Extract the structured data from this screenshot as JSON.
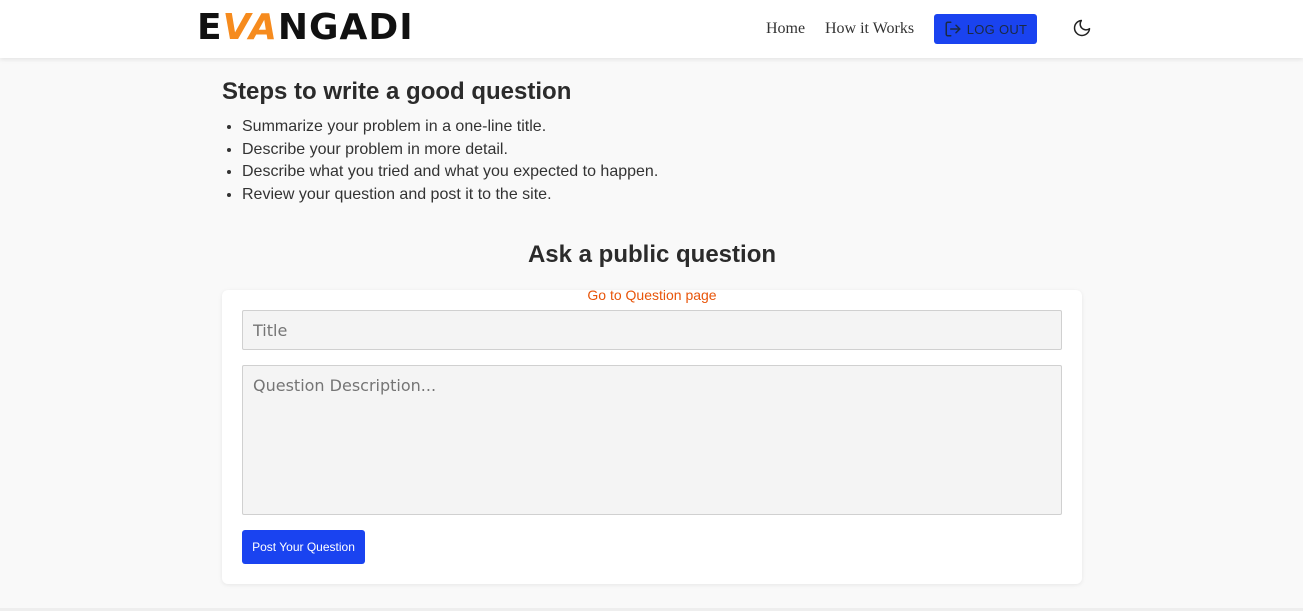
{
  "header": {
    "logo": "EVANGADI",
    "nav": {
      "home": "Home",
      "how_it_works": "How it Works"
    },
    "logout_label": "LOG OUT",
    "icons": {
      "logout": "logout-icon",
      "theme": "moon-icon"
    }
  },
  "steps": {
    "title": "Steps to write a good question",
    "items": [
      "Summarize your problem in a one-line title.",
      "Describe your problem in more detail.",
      "Describe what you tried and what you expected to happen.",
      "Review your question and post it to the site."
    ]
  },
  "ask": {
    "title": "Ask a public question",
    "goto_link": "Go to Question page",
    "title_placeholder": "Title",
    "description_placeholder": "Question Description...",
    "submit_label": "Post Your Question"
  },
  "colors": {
    "accent": "#1a43f0",
    "link": "#e8550a",
    "logo_accent": "#f68b1e"
  }
}
